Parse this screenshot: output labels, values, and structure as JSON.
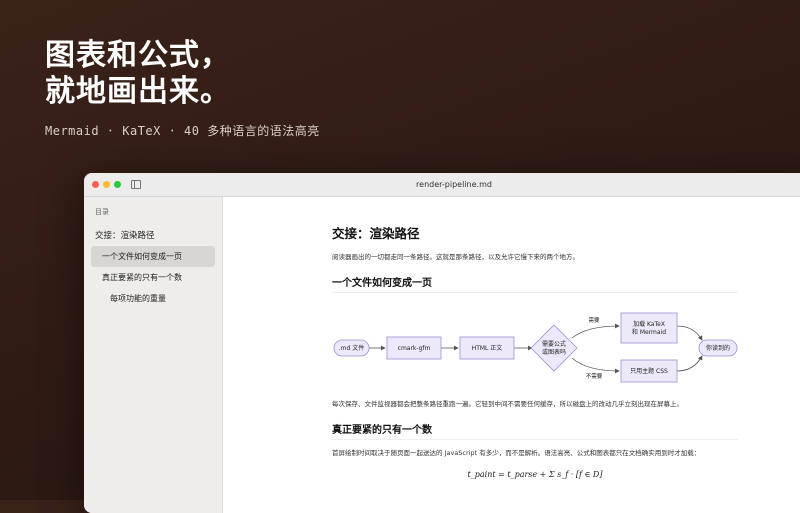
{
  "hero": {
    "title_line1": "图表和公式，",
    "title_line2": "就地画出来。",
    "subtitle": "Mermaid · KaTeX · 40 多种语言的语法高亮"
  },
  "window": {
    "title": "render-pipeline.md"
  },
  "sidebar": {
    "heading": "目录",
    "items": [
      {
        "label": "交接：渲染路径",
        "level": 1
      },
      {
        "label": "一个文件如何变成一页",
        "level": 2,
        "active": true
      },
      {
        "label": "真正要紧的只有一个数",
        "level": 2
      },
      {
        "label": "每项功能的重量",
        "level": 3
      }
    ]
  },
  "doc": {
    "h1": "交接：渲染路径",
    "intro": "阅读器画出的一切都走同一条路径。这就是那条路径，以及允许它慢下来的两个地方。",
    "h2_a": "一个文件如何变成一页",
    "para_after_flow": "每次保存、文件监视器都会把整条路径重跑一遍。它轻到中间不需要任何缓存，所以磁盘上的改动几乎立刻出现在屏幕上。",
    "h2_b": "真正要紧的只有一个数",
    "para_b": "首屏绘制时间取决于随页面一起送达的 JavaScript 有多少，而不是解析。语法高亮、公式和图表都只在文档确实用到时才加载：",
    "formula": "t_paint = t_parse + Σ s_f · [f ∈ D]"
  },
  "flowchart": {
    "nodes": {
      "md": ".md 文件",
      "cmark": "cmark-gfm",
      "html": "HTML 正文",
      "decision_line1": "需要公式",
      "decision_line2": "或图表吗",
      "katex_line1": "加载 KaTeX",
      "katex_line2": "和 Mermaid",
      "css": "只用主题 CSS",
      "done": "你读到的"
    },
    "edges": {
      "yes": "需要",
      "no": "不需要"
    },
    "colors": {
      "node_fill": "#ede9fb",
      "node_stroke": "#9d8fd8"
    }
  }
}
